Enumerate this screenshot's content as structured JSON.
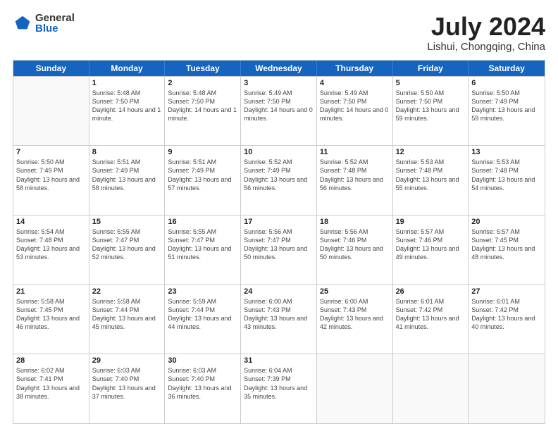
{
  "header": {
    "logo_general": "General",
    "logo_blue": "Blue",
    "title": "July 2024",
    "location": "Lishui, Chongqing, China"
  },
  "days_of_week": [
    "Sunday",
    "Monday",
    "Tuesday",
    "Wednesday",
    "Thursday",
    "Friday",
    "Saturday"
  ],
  "weeks": [
    [
      {
        "day": "",
        "empty": true
      },
      {
        "day": "1",
        "sunrise": "5:48 AM",
        "sunset": "7:50 PM",
        "daylight": "14 hours and 1 minute."
      },
      {
        "day": "2",
        "sunrise": "5:48 AM",
        "sunset": "7:50 PM",
        "daylight": "14 hours and 1 minute."
      },
      {
        "day": "3",
        "sunrise": "5:49 AM",
        "sunset": "7:50 PM",
        "daylight": "14 hours and 0 minutes."
      },
      {
        "day": "4",
        "sunrise": "5:49 AM",
        "sunset": "7:50 PM",
        "daylight": "14 hours and 0 minutes."
      },
      {
        "day": "5",
        "sunrise": "5:50 AM",
        "sunset": "7:50 PM",
        "daylight": "13 hours and 59 minutes."
      },
      {
        "day": "6",
        "sunrise": "5:50 AM",
        "sunset": "7:49 PM",
        "daylight": "13 hours and 59 minutes."
      }
    ],
    [
      {
        "day": "7",
        "sunrise": "5:50 AM",
        "sunset": "7:49 PM",
        "daylight": "13 hours and 58 minutes."
      },
      {
        "day": "8",
        "sunrise": "5:51 AM",
        "sunset": "7:49 PM",
        "daylight": "13 hours and 58 minutes."
      },
      {
        "day": "9",
        "sunrise": "5:51 AM",
        "sunset": "7:49 PM",
        "daylight": "13 hours and 57 minutes."
      },
      {
        "day": "10",
        "sunrise": "5:52 AM",
        "sunset": "7:49 PM",
        "daylight": "13 hours and 56 minutes."
      },
      {
        "day": "11",
        "sunrise": "5:52 AM",
        "sunset": "7:48 PM",
        "daylight": "13 hours and 56 minutes."
      },
      {
        "day": "12",
        "sunrise": "5:53 AM",
        "sunset": "7:48 PM",
        "daylight": "13 hours and 55 minutes."
      },
      {
        "day": "13",
        "sunrise": "5:53 AM",
        "sunset": "7:48 PM",
        "daylight": "13 hours and 54 minutes."
      }
    ],
    [
      {
        "day": "14",
        "sunrise": "5:54 AM",
        "sunset": "7:48 PM",
        "daylight": "13 hours and 53 minutes."
      },
      {
        "day": "15",
        "sunrise": "5:55 AM",
        "sunset": "7:47 PM",
        "daylight": "13 hours and 52 minutes."
      },
      {
        "day": "16",
        "sunrise": "5:55 AM",
        "sunset": "7:47 PM",
        "daylight": "13 hours and 51 minutes."
      },
      {
        "day": "17",
        "sunrise": "5:56 AM",
        "sunset": "7:47 PM",
        "daylight": "13 hours and 50 minutes."
      },
      {
        "day": "18",
        "sunrise": "5:56 AM",
        "sunset": "7:46 PM",
        "daylight": "13 hours and 50 minutes."
      },
      {
        "day": "19",
        "sunrise": "5:57 AM",
        "sunset": "7:46 PM",
        "daylight": "13 hours and 49 minutes."
      },
      {
        "day": "20",
        "sunrise": "5:57 AM",
        "sunset": "7:45 PM",
        "daylight": "13 hours and 48 minutes."
      }
    ],
    [
      {
        "day": "21",
        "sunrise": "5:58 AM",
        "sunset": "7:45 PM",
        "daylight": "13 hours and 46 minutes."
      },
      {
        "day": "22",
        "sunrise": "5:58 AM",
        "sunset": "7:44 PM",
        "daylight": "13 hours and 45 minutes."
      },
      {
        "day": "23",
        "sunrise": "5:59 AM",
        "sunset": "7:44 PM",
        "daylight": "13 hours and 44 minutes."
      },
      {
        "day": "24",
        "sunrise": "6:00 AM",
        "sunset": "7:43 PM",
        "daylight": "13 hours and 43 minutes."
      },
      {
        "day": "25",
        "sunrise": "6:00 AM",
        "sunset": "7:43 PM",
        "daylight": "13 hours and 42 minutes."
      },
      {
        "day": "26",
        "sunrise": "6:01 AM",
        "sunset": "7:42 PM",
        "daylight": "13 hours and 41 minutes."
      },
      {
        "day": "27",
        "sunrise": "6:01 AM",
        "sunset": "7:42 PM",
        "daylight": "13 hours and 40 minutes."
      }
    ],
    [
      {
        "day": "28",
        "sunrise": "6:02 AM",
        "sunset": "7:41 PM",
        "daylight": "13 hours and 38 minutes."
      },
      {
        "day": "29",
        "sunrise": "6:03 AM",
        "sunset": "7:40 PM",
        "daylight": "13 hours and 37 minutes."
      },
      {
        "day": "30",
        "sunrise": "6:03 AM",
        "sunset": "7:40 PM",
        "daylight": "13 hours and 36 minutes."
      },
      {
        "day": "31",
        "sunrise": "6:04 AM",
        "sunset": "7:39 PM",
        "daylight": "13 hours and 35 minutes."
      },
      {
        "day": "",
        "empty": true
      },
      {
        "day": "",
        "empty": true
      },
      {
        "day": "",
        "empty": true
      }
    ]
  ]
}
